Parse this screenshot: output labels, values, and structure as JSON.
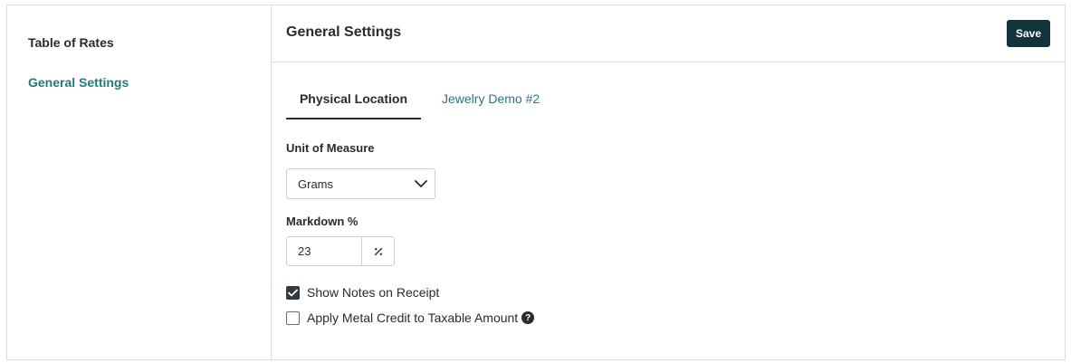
{
  "sidebar": {
    "items": [
      {
        "label": "Table of Rates"
      },
      {
        "label": "General Settings"
      }
    ]
  },
  "header": {
    "title": "General Settings",
    "save_label": "Save"
  },
  "tabs": [
    {
      "label": "Physical Location",
      "active": true
    },
    {
      "label": "Jewelry Demo #2",
      "active": false
    }
  ],
  "form": {
    "unit_label": "Unit of Measure",
    "unit_value": "Grams",
    "markdown_label": "Markdown %",
    "markdown_value": "23",
    "markdown_addon": "%",
    "show_notes_label": "Show Notes on Receipt",
    "show_notes_checked": true,
    "metal_credit_label": "Apply Metal Credit to Taxable Amount",
    "metal_credit_checked": false,
    "help_icon": "?"
  },
  "colors": {
    "accent": "#1f7a80",
    "save_button": "#10343a",
    "checkbox_checked": "#2e3b43"
  },
  "icons": {
    "select_arrow": "chevron-down-icon",
    "addon": "percent-icon",
    "checked": "checkmark-icon",
    "help": "question-circle-icon"
  }
}
